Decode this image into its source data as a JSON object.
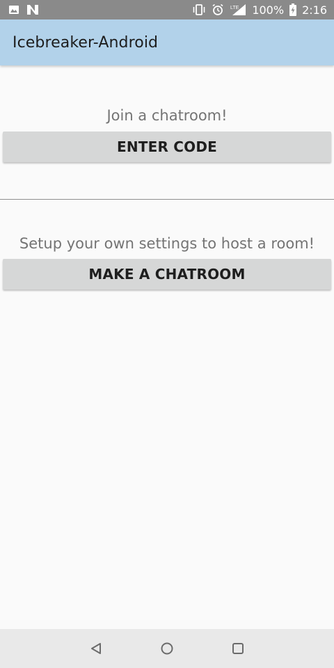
{
  "status_bar": {
    "battery_percent": "100%",
    "time": "2:16",
    "network_label": "LTE",
    "icons": [
      "image-icon",
      "n-icon",
      "vibrate-icon",
      "alarm-icon",
      "signal-icon",
      "battery-icon"
    ]
  },
  "app_bar": {
    "title": "Icebreaker-Android",
    "background_color": "#b2d2ea"
  },
  "join_section": {
    "prompt": "Join a chatroom!",
    "button_label": "ENTER CODE"
  },
  "host_section": {
    "prompt": "Setup your own settings to host a room!",
    "button_label": "MAKE A CHATROOM"
  },
  "nav_bar": {
    "icons": [
      "back-icon",
      "home-icon",
      "recents-icon"
    ]
  }
}
